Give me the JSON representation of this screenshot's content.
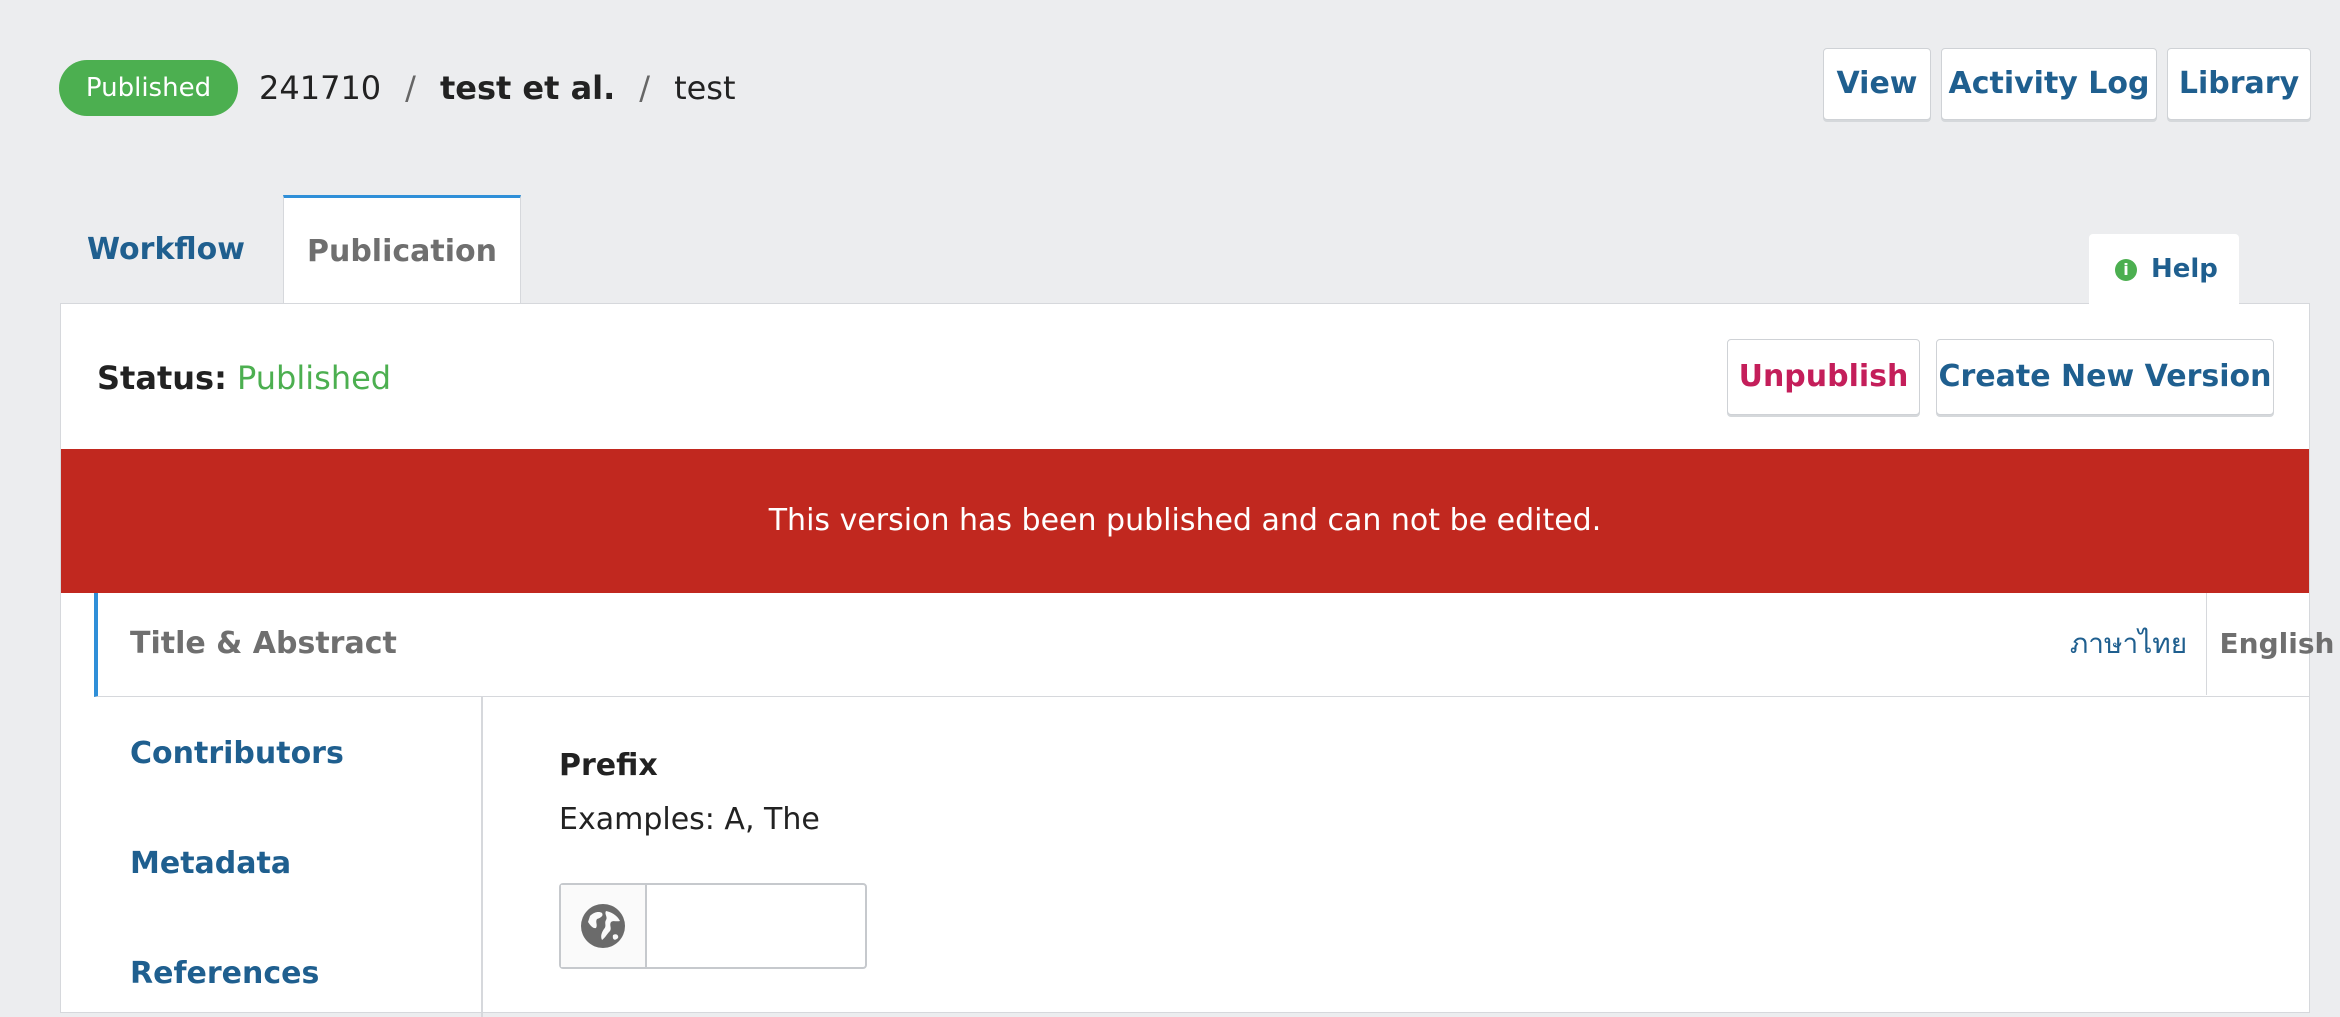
{
  "header": {
    "status_badge": "Published",
    "breadcrumb": {
      "id": "241710",
      "authors": "test et al.",
      "title": "test",
      "separator": "/"
    },
    "buttons": {
      "view": "View",
      "activity_log": "Activity Log",
      "library": "Library"
    }
  },
  "tabs": {
    "workflow": "Workflow",
    "publication": "Publication",
    "help": "Help",
    "help_icon": "i"
  },
  "panel": {
    "status_label": "Status:",
    "status_value": "Published",
    "unpublish": "Unpublish",
    "create_new_version": "Create New Version",
    "notice": "This version has been published and can not be edited.",
    "section_title": "Title & Abstract",
    "languages": [
      "ภาษาไทย",
      "English"
    ],
    "nav": {
      "contributors": "Contributors",
      "metadata": "Metadata",
      "references": "References"
    },
    "form": {
      "prefix_label": "Prefix",
      "prefix_description": "Examples: A, The",
      "prefix_value": ""
    }
  },
  "colors": {
    "published_green": "#4caf50",
    "link_blue": "#1f5f8f",
    "unpublish_red": "#c41e5a",
    "notice_red": "#c1281f",
    "accent_blue": "#2f8fd8"
  }
}
